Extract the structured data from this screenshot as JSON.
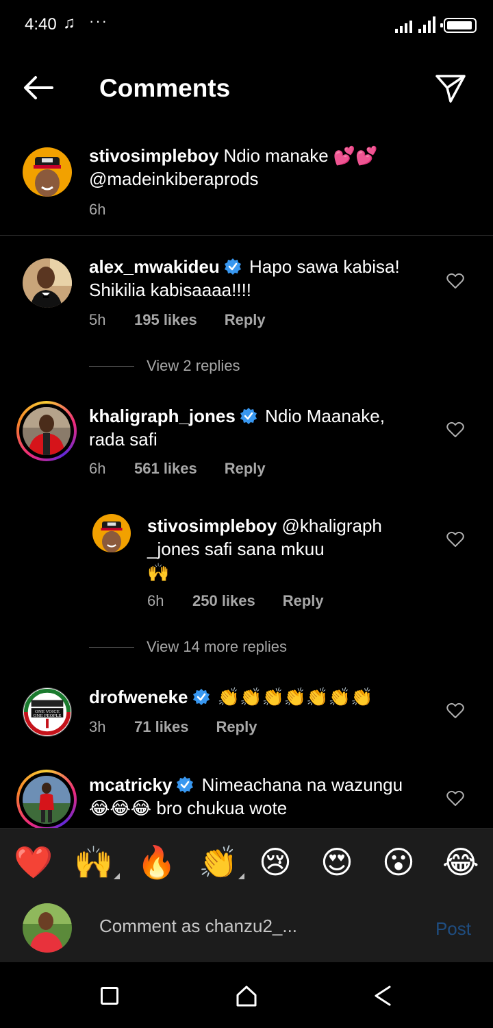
{
  "status_bar": {
    "time": "4:40",
    "music_icon": "music-note-icon",
    "more": "···"
  },
  "header": {
    "title": "Comments",
    "back_icon": "arrow-left-icon",
    "send_icon": "paper-plane-icon"
  },
  "caption": {
    "username": "stivosimpleboy",
    "text": "Ndio manake 💕💕",
    "text2": "@madeinkiberaprods",
    "time": "6h"
  },
  "comments": [
    {
      "username": "alex_mwakideu",
      "verified": true,
      "text": "Hapo sawa kabisa!",
      "text2": "Shikilia kabisaaaa!!!!",
      "time": "5h",
      "likes": "195 likes",
      "reply": "Reply",
      "view_replies": "View 2 replies"
    },
    {
      "username": "khaligraph_jones",
      "verified": true,
      "text": "Ndio Maanake,",
      "text2": "rada safi",
      "time": "6h",
      "likes": "561 likes",
      "reply": "Reply",
      "reply_item": {
        "username": "stivosimpleboy",
        "text": "@khaligraph",
        "text2": "_jones safi sana mkuu",
        "text3": "🙌",
        "time": "6h",
        "likes": "250 likes",
        "reply": "Reply"
      },
      "view_replies": "View 14 more replies"
    },
    {
      "username": "drofweneke",
      "verified": true,
      "text": "👏👏👏👏👏👏👏",
      "time": "3h",
      "likes": "71 likes",
      "reply": "Reply",
      "avatar_text1": "ONE VOICE",
      "avatar_text2": "ONE PEOPLE"
    },
    {
      "username": "mcatricky",
      "verified": true,
      "text": "Nimeachana na wazungu",
      "text2": "😂😂😂 bro chukua wote"
    }
  ],
  "emoji_bar": [
    "❤️",
    "🙌",
    "🔥",
    "👏",
    "😢",
    "😍",
    "😮",
    "😂"
  ],
  "comment_input": {
    "placeholder": "Comment as chanzu2_...",
    "post_label": "Post"
  },
  "colors": {
    "background": "#000000",
    "muted": "#a8a8a8",
    "verified": "#3897f0",
    "post_disabled": "#1f4d80"
  }
}
